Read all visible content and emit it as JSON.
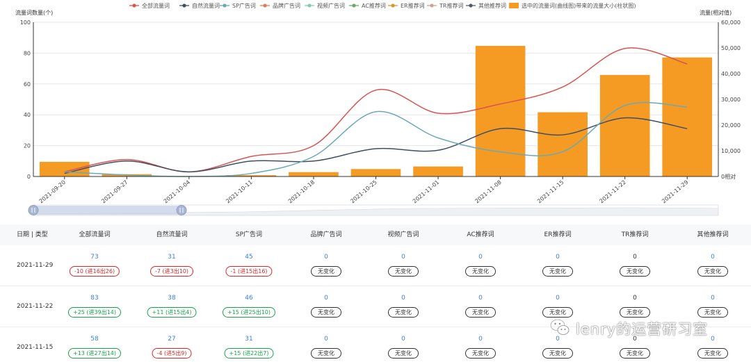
{
  "legend": [
    {
      "name": "全部流量词",
      "color": "#d9534f",
      "kind": "line"
    },
    {
      "name": "自然流量词",
      "color": "#3f4f63",
      "kind": "line"
    },
    {
      "name": "SP广告词",
      "color": "#6aaab5",
      "kind": "line"
    },
    {
      "name": "品牌广告词",
      "color": "#e07b5a",
      "kind": "line"
    },
    {
      "name": "视频广告词",
      "color": "#8cc7b5",
      "kind": "line"
    },
    {
      "name": "AC推荐词",
      "color": "#6fa86a",
      "kind": "line"
    },
    {
      "name": "ER推荐词",
      "color": "#d59a2c",
      "kind": "line"
    },
    {
      "name": "TR推荐词",
      "color": "#d3a190",
      "kind": "line"
    },
    {
      "name": "其他推荐词",
      "color": "#555a66",
      "kind": "line"
    },
    {
      "name": "选中的流量词(曲线图)带来的流量大小(柱状图)",
      "color": "#f59a23",
      "kind": "bar"
    }
  ],
  "chart_data": {
    "type": "bar+line",
    "y_left_label": "流量词数量(个)",
    "y_right_label": "流量(相对值)",
    "y_left_ticks": [
      "0",
      "20",
      "40",
      "60",
      "80",
      "100"
    ],
    "y_right_ticks": [
      "0相对",
      "10,000",
      "20,000",
      "30,000",
      "40,000",
      "50,000",
      "60,000"
    ],
    "ylim_left": [
      0,
      100
    ],
    "ylim_right": [
      0,
      60000
    ],
    "categories": [
      "2021-09-20",
      "2021-09-27",
      "2021-10-04",
      "2021-10-11",
      "2021-10-18",
      "2021-10-25",
      "2021-11-01",
      "2021-11-08",
      "2021-11-15",
      "2021-11-22",
      "2021-11-29"
    ],
    "bars": {
      "name": "选中的流量词(曲线图)带来的流量大小(柱状图)",
      "color": "#f59a23",
      "values": [
        5700,
        900,
        100,
        500,
        1700,
        2900,
        3900,
        50800,
        25000,
        39500,
        46300
      ]
    },
    "series": [
      {
        "name": "全部流量词",
        "color": "#d9534f",
        "values": [
          3,
          11,
          3,
          13,
          20,
          56,
          41,
          47,
          58,
          83,
          73
        ]
      },
      {
        "name": "自然流量词",
        "color": "#3f4f63",
        "values": [
          2,
          10,
          3,
          10,
          10,
          18,
          17,
          31,
          27,
          38,
          31
        ]
      },
      {
        "name": "SP广告词",
        "color": "#6aaab5",
        "values": [
          3,
          1,
          0,
          2,
          13,
          42,
          25,
          16,
          16,
          46,
          45
        ]
      }
    ],
    "grid": true,
    "legend_position": "top"
  },
  "table": {
    "headers": [
      "日期 | 类型",
      "全部流量词",
      "自然流量词",
      "SP广告词",
      "品牌广告词",
      "视频广告词",
      "AC推荐词",
      "ER推荐词",
      "TR推荐词",
      "其他推荐词"
    ],
    "rows": [
      {
        "date": "2021-11-29",
        "cells": [
          {
            "value": "73",
            "badge": "-10 (进16出26)",
            "trend": "down"
          },
          {
            "value": "31",
            "badge": "-7 (进3出10)",
            "trend": "down"
          },
          {
            "value": "45",
            "badge": "-1 (进15出16)",
            "trend": "down"
          },
          {
            "value": "0",
            "badge": "无变化",
            "trend": "none"
          },
          {
            "value": "0",
            "badge": "无变化",
            "trend": "none"
          },
          {
            "value": "0",
            "badge": "无变化",
            "trend": "none"
          },
          {
            "value": "0",
            "badge": "无变化",
            "trend": "none"
          },
          {
            "value": "0",
            "badge": "无变化",
            "trend": "none",
            "black": true
          },
          {
            "value": "0",
            "badge": "无变化",
            "trend": "none"
          }
        ]
      },
      {
        "date": "2021-11-22",
        "cells": [
          {
            "value": "83",
            "badge": "+25 (进39出14)",
            "trend": "up"
          },
          {
            "value": "38",
            "badge": "+11 (进15出4)",
            "trend": "up"
          },
          {
            "value": "46",
            "badge": "+15 (进25出10)",
            "trend": "up"
          },
          {
            "value": "0",
            "badge": "无变化",
            "trend": "none"
          },
          {
            "value": "0",
            "badge": "无变化",
            "trend": "none"
          },
          {
            "value": "0",
            "badge": "无变化",
            "trend": "none"
          },
          {
            "value": "0",
            "badge": "无变化",
            "trend": "none"
          },
          {
            "value": "0",
            "badge": "无变化",
            "trend": "none",
            "black": true
          },
          {
            "value": "0",
            "badge": "无变化",
            "trend": "none"
          }
        ]
      },
      {
        "date": "2021-11-15",
        "cells": [
          {
            "value": "58",
            "badge": "+13 (进27出14)",
            "trend": "up"
          },
          {
            "value": "27",
            "badge": "-4 (进5出9)",
            "trend": "down"
          },
          {
            "value": "31",
            "badge": "+15 (进22出7)",
            "trend": "up"
          },
          {
            "value": "0",
            "badge": "无变化",
            "trend": "none"
          },
          {
            "value": "0",
            "badge": "无变化",
            "trend": "none"
          },
          {
            "value": "0",
            "badge": "无变化",
            "trend": "none"
          },
          {
            "value": "0",
            "badge": "无变化",
            "trend": "none"
          },
          {
            "value": "0",
            "badge": "无变化",
            "trend": "none",
            "black": true
          },
          {
            "value": "0",
            "badge": "无变化",
            "trend": "none"
          }
        ]
      }
    ]
  },
  "watermark": {
    "text": "lenry的运营研习室",
    "icon": "wechat-icon"
  }
}
